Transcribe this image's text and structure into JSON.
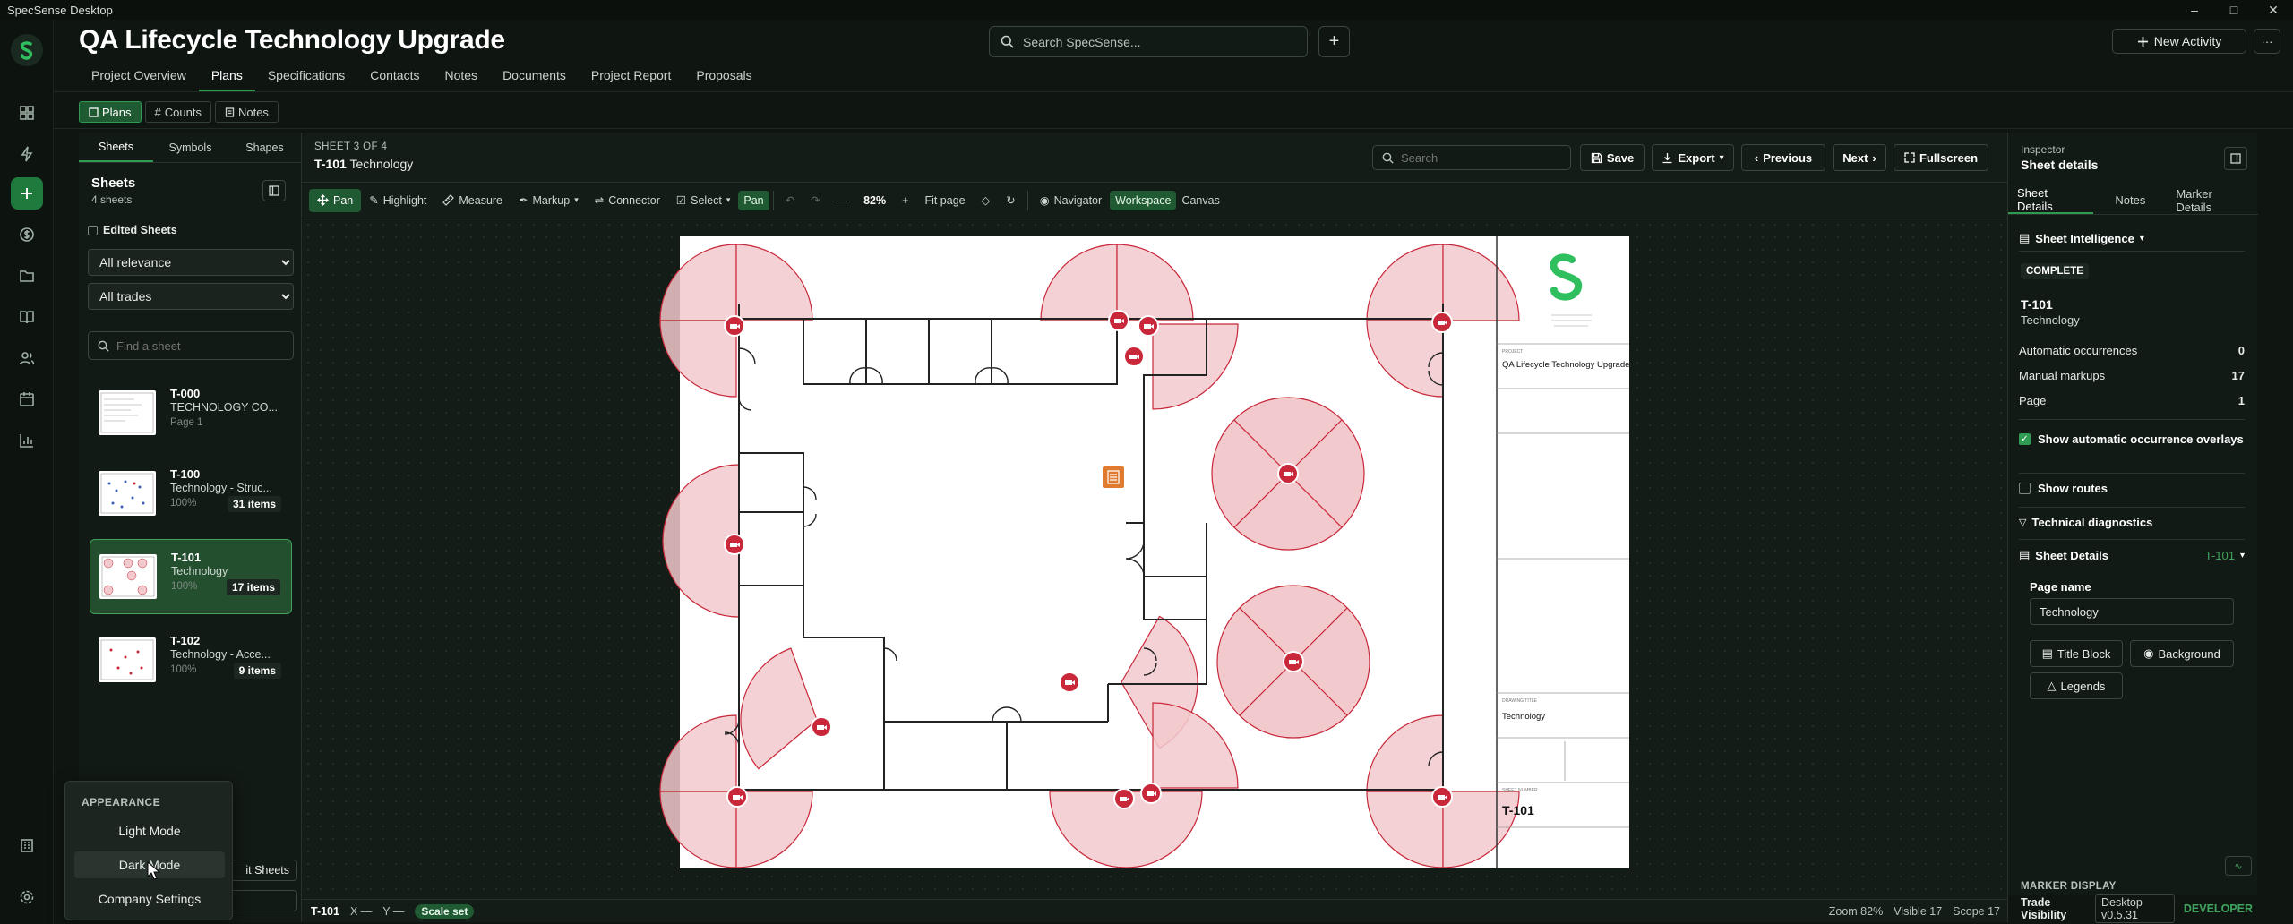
{
  "window": {
    "title": "SpecSense Desktop",
    "controls": [
      "–",
      "▢",
      "✕"
    ]
  },
  "header": {
    "project_title": "QA Lifecycle Technology Upgrade",
    "search_placeholder": "Search SpecSense...",
    "plus_label": "+",
    "new_activity_label": "New Activity",
    "more_label": "···"
  },
  "nav": {
    "tabs": [
      "Project Overview",
      "Plans",
      "Specifications",
      "Contacts",
      "Notes",
      "Documents",
      "Project Report",
      "Proposals"
    ],
    "active": "Plans"
  },
  "subtabs": {
    "plans": "Plans",
    "counts": "Counts",
    "notes": "Notes"
  },
  "sheets_panel": {
    "tabs": [
      "Sheets",
      "Symbols",
      "Shapes"
    ],
    "title": "Sheets",
    "count": "4 sheets",
    "edited_label": "Edited Sheets",
    "relevance_value": "All relevance",
    "trades_value": "All trades",
    "find_placeholder": "Find a sheet",
    "edit_sheets_label": "it Sheets",
    "items": [
      {
        "code": "T-000",
        "name": "TECHNOLOGY CO...",
        "meta": "Page 1",
        "items": ""
      },
      {
        "code": "T-100",
        "name": "Technology - Struc...",
        "meta": "100%",
        "items": "31 items"
      },
      {
        "code": "T-101",
        "name": "Technology",
        "meta": "100%",
        "items": "17 items"
      },
      {
        "code": "T-102",
        "name": "Technology - Acce...",
        "meta": "100%",
        "items": "9 items"
      }
    ]
  },
  "viewer": {
    "sheet_of": "SHEET 3 OF 4",
    "sheet_code": "T-101",
    "sheet_name": "Technology",
    "search_placeholder": "Search",
    "save_label": "Save",
    "export_label": "Export",
    "previous_label": "Previous",
    "next_label": "Next",
    "fullscreen_label": "Fullscreen",
    "toolbar": {
      "pan": "Pan",
      "highlight": "Highlight",
      "measure": "Measure",
      "markup": "Markup",
      "connector": "Connector",
      "select": "Select",
      "pan_pill": "Pan",
      "zoom": "82%",
      "fit_page": "Fit page",
      "navigator": "Navigator",
      "workspace": "Workspace",
      "canvas": "Canvas"
    },
    "status": {
      "sheet": "T-101",
      "x": "X —",
      "y": "Y —",
      "scale": "Scale set",
      "zoom": "Zoom 82%",
      "visible": "Visible 17",
      "scope": "Scope 17"
    }
  },
  "titleblock": {
    "project_label": "PROJECT",
    "project_name": "QA Lifecycle Technology Upgrade",
    "sheet_title_label": "DRAWING TITLE",
    "sheet_title": "Technology",
    "sheet_number_label": "SHEET NUMBER",
    "sheet_number": "T-101"
  },
  "inspector": {
    "kicker": "Inspector",
    "title": "Sheet details",
    "tabs": [
      "Sheet Details",
      "Notes",
      "Marker Details"
    ],
    "intelligence_label": "Sheet Intelligence",
    "status_badge": "COMPLETE",
    "sheet_code": "T-101",
    "sheet_name": "Technology",
    "rows": [
      {
        "label": "Automatic occurrences",
        "value": "0"
      },
      {
        "label": "Manual markups",
        "value": "17"
      },
      {
        "label": "Page",
        "value": "1"
      }
    ],
    "show_auto_label": "Show automatic occurrence overlays",
    "show_routes_label": "Show routes",
    "tech_diag_label": "Technical diagnostics",
    "sheet_details_label": "Sheet Details",
    "sheet_details_code": "T-101",
    "page_name_label": "Page name",
    "page_name_value": "Technology",
    "title_block_label": "Title Block",
    "background_label": "Background",
    "legends_label": "Legends",
    "marker_display_label": "MARKER DISPLAY",
    "trade_visibility_label": "Trade Visibility",
    "version_label": "Desktop v0.5.31",
    "developer_label": "DEVELOPER"
  },
  "appearance_menu": {
    "heading": "APPEARANCE",
    "items": [
      "Light Mode",
      "Dark Mode",
      "Company Settings"
    ]
  },
  "colors": {
    "accent": "#2e9a52",
    "marker": "#c8283a",
    "coverage": "#f2c9cc"
  }
}
